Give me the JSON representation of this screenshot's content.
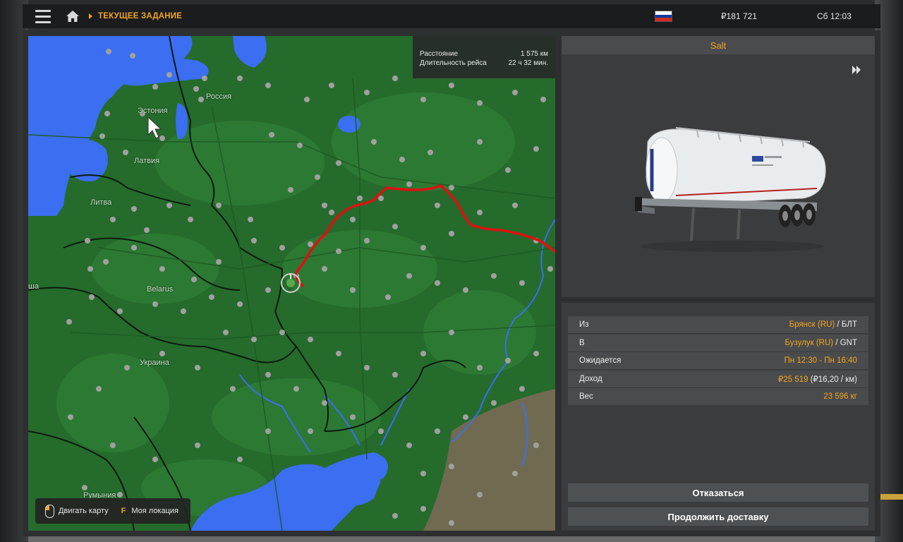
{
  "topbar": {
    "breadcrumb": "ТЕКУЩЕЕ ЗАДАНИЕ",
    "money": "₽181 721",
    "clock": "Сб 12:03",
    "flag_colors": [
      "#ffffff",
      "#0039a6",
      "#d52b1e"
    ]
  },
  "map": {
    "info": {
      "distance_label": "Расстояние",
      "distance_value": "1 575 км",
      "duration_label": "Длительность рейса",
      "duration_value": "22 ч 32 мин."
    },
    "labels": {
      "russia": "Россия",
      "estonia": "Эстония",
      "latvia": "Латвия",
      "lithuania": "Литва",
      "belarus": "Belarus",
      "ukraine": "Украина",
      "romania": "Румыния",
      "edge": "ша"
    },
    "hints": {
      "move_map": "Двигать карту",
      "key": "F",
      "my_location": "Моя локация"
    },
    "colors": {
      "land": "#256b2c",
      "land_light": "#2e7d35",
      "water": "#3b6ef0",
      "route": "#e01010",
      "steppe": "#6e6a4e"
    }
  },
  "cargo": {
    "name": "Salt"
  },
  "details": {
    "from_label": "Из",
    "from_city": "Брянск (RU)",
    "from_company": "/ БЛТ",
    "to_label": "В",
    "to_city": "Бузулук (RU)",
    "to_company": "/ GNT",
    "expected_label": "Ожидается",
    "expected_value": "Пн 12:30 - Пн 16:40",
    "income_label": "Доход",
    "income_value": "₽25 519",
    "income_rate": "(₽16,20 / км)",
    "weight_label": "Вес",
    "weight_value": "23 596 кг"
  },
  "actions": {
    "cancel": "Отказаться",
    "continue": "Продолжить доставку"
  }
}
